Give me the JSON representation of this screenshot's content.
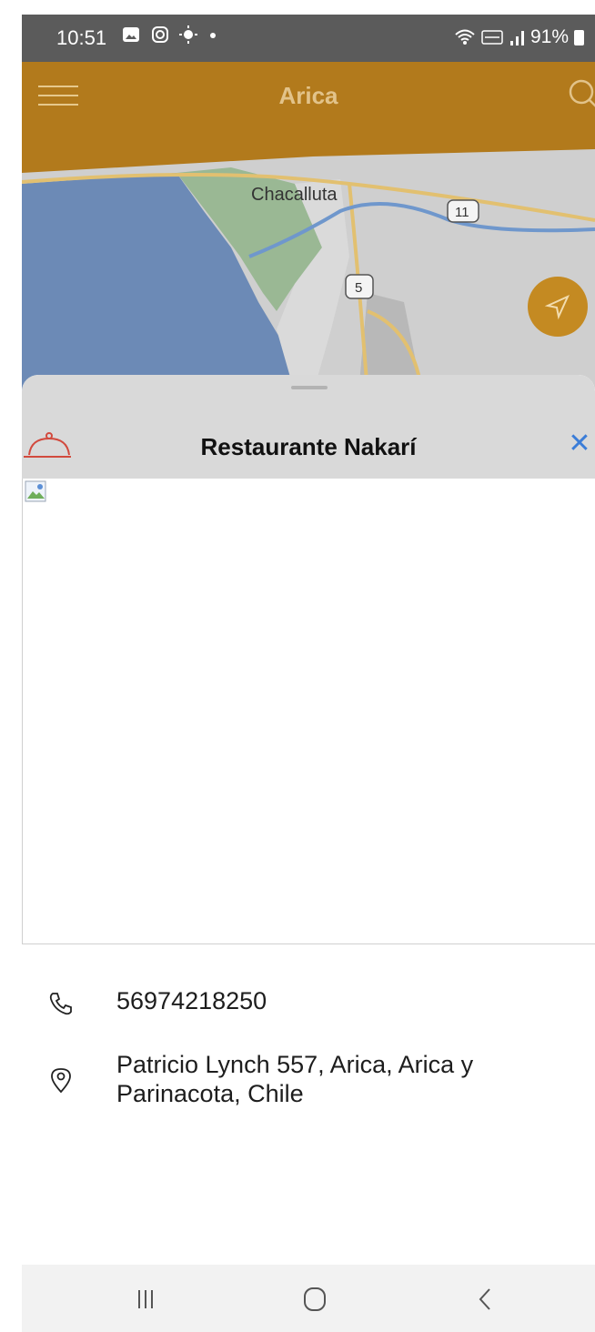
{
  "status_bar": {
    "time": "10:51",
    "battery": "91%",
    "left_icons": [
      "gallery-icon",
      "instagram-icon",
      "brightness-icon",
      "dot-icon"
    ],
    "right_icons": [
      "wifi-icon",
      "volte-icon",
      "signal-icon",
      "battery-icon"
    ]
  },
  "app_bar": {
    "title": "Arica",
    "color": "#b27a1c"
  },
  "map": {
    "place_label": "Chacalluta",
    "route_badges": [
      "11",
      "5"
    ]
  },
  "place": {
    "name": "Restaurante Nakarí",
    "phone": "56974218250",
    "address": "Patricio Lynch 557, Arica, Arica y Parinacota, Chile"
  },
  "nav_bar": {
    "buttons": [
      "recents-icon",
      "home-icon",
      "back-icon"
    ]
  }
}
